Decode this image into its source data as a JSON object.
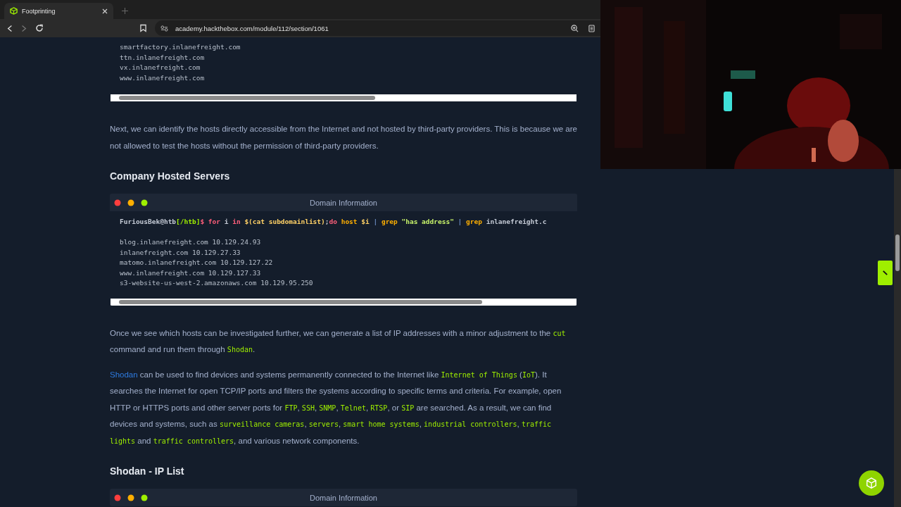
{
  "tab": {
    "title": "Footprinting",
    "selected": true
  },
  "address_bar": {
    "url": "academy.hackthebox.com/module/112/section/1061"
  },
  "blocks": [
    {
      "kind": "output",
      "lines": [
        "smartfactory.inlanefreight.com",
        "ttn.inlanefreight.com",
        "vx.inlanefreight.com",
        "www.inlanefreight.com"
      ]
    },
    {
      "kind": "para",
      "segments": [
        {
          "kind": "text",
          "text": "Next, we can identify the hosts directly accessible from the Internet and not hosted by third-party providers. This is because we are not allowed to test the hosts without the permission of third-party providers."
        }
      ]
    },
    {
      "kind": "heading",
      "text": "Company Hosted Servers"
    },
    {
      "kind": "terminal",
      "title": "Domain Information",
      "command": [
        {
          "kind": "prompt",
          "text": "FuriousBek@htb"
        },
        {
          "kind": "path",
          "text": "[/htb]"
        },
        {
          "kind": "dollar",
          "text": "$ "
        },
        {
          "kind": "keyword",
          "text": "for"
        },
        {
          "kind": "plain",
          "text": " i "
        },
        {
          "kind": "keyword",
          "text": "in"
        },
        {
          "kind": "sub",
          "text": " $(cat subdomainlist)"
        },
        {
          "kind": "plain",
          "text": ";"
        },
        {
          "kind": "keyword",
          "text": "do"
        },
        {
          "kind": "cmd",
          "text": " host"
        },
        {
          "kind": "sub",
          "text": " $i"
        },
        {
          "kind": "pipe",
          "text": " | "
        },
        {
          "kind": "cmd",
          "text": "grep"
        },
        {
          "kind": "string",
          "text": " \"has address\""
        },
        {
          "kind": "pipe",
          "text": " | "
        },
        {
          "kind": "cmd",
          "text": "grep"
        },
        {
          "kind": "plain",
          "text": " inlanefreight.c"
        }
      ],
      "lines": [
        "blog.inlanefreight.com 10.129.24.93",
        "inlanefreight.com 10.129.27.33",
        "matomo.inlanefreight.com 10.129.127.22",
        "www.inlanefreight.com 10.129.127.33",
        "s3-website-us-west-2.amazonaws.com 10.129.95.250"
      ]
    },
    {
      "kind": "para",
      "segments": [
        {
          "kind": "text",
          "text": "Once we see which hosts can be investigated further, we can generate a list of IP addresses with a minor adjustment to the "
        },
        {
          "kind": "code",
          "text": "cut"
        },
        {
          "kind": "text",
          "text": " command and run them through "
        },
        {
          "kind": "code",
          "text": "Shodan"
        },
        {
          "kind": "text",
          "text": "."
        }
      ]
    },
    {
      "kind": "para",
      "segments": [
        {
          "kind": "link",
          "text": "Shodan"
        },
        {
          "kind": "text",
          "text": " can be used to find devices and systems permanently connected to the Internet like "
        },
        {
          "kind": "code",
          "text": "Internet of Things"
        },
        {
          "kind": "text",
          "text": " ("
        },
        {
          "kind": "code",
          "text": "IoT"
        },
        {
          "kind": "text",
          "text": "). It searches the Internet for open TCP/IP ports and filters the systems according to specific terms and criteria. For example, open HTTP or HTTPS ports and other server ports for "
        },
        {
          "kind": "code",
          "text": "FTP"
        },
        {
          "kind": "text",
          "text": ", "
        },
        {
          "kind": "code",
          "text": "SSH"
        },
        {
          "kind": "text",
          "text": ", "
        },
        {
          "kind": "code",
          "text": "SNMP"
        },
        {
          "kind": "text",
          "text": ", "
        },
        {
          "kind": "code",
          "text": "Telnet"
        },
        {
          "kind": "text",
          "text": ", "
        },
        {
          "kind": "code",
          "text": "RTSP"
        },
        {
          "kind": "text",
          "text": ", or "
        },
        {
          "kind": "code",
          "text": "SIP"
        },
        {
          "kind": "text",
          "text": " are searched. As a result, we can find devices and systems, such as "
        },
        {
          "kind": "code",
          "text": "surveillance cameras"
        },
        {
          "kind": "text",
          "text": ", "
        },
        {
          "kind": "code",
          "text": "servers"
        },
        {
          "kind": "text",
          "text": ", "
        },
        {
          "kind": "code",
          "text": "smart home systems"
        },
        {
          "kind": "text",
          "text": ", "
        },
        {
          "kind": "code",
          "text": "industrial controllers"
        },
        {
          "kind": "text",
          "text": ", "
        },
        {
          "kind": "code",
          "text": "traffic lights"
        },
        {
          "kind": "text",
          "text": " and "
        },
        {
          "kind": "code",
          "text": "traffic controllers"
        },
        {
          "kind": "text",
          "text": ", and various network components."
        }
      ]
    },
    {
      "kind": "heading",
      "text": "Shodan - IP List"
    },
    {
      "kind": "terminal",
      "title": "Domain Information"
    }
  ]
}
